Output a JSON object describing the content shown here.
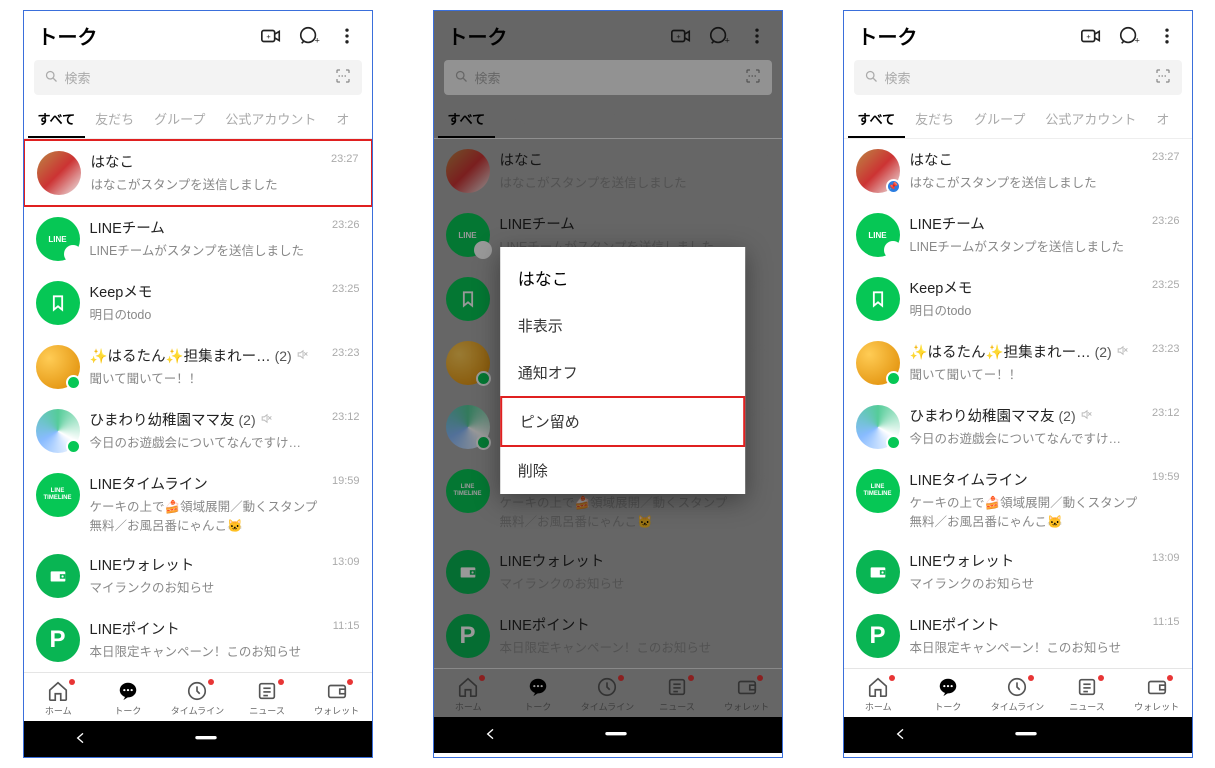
{
  "header": {
    "title": "トーク"
  },
  "search": {
    "placeholder": "検索"
  },
  "tabs": [
    "すべて",
    "友だち",
    "グループ",
    "公式アカウント",
    "オ"
  ],
  "chats": [
    {
      "name": "はなこ",
      "preview": "はなこがスタンプを送信しました",
      "time": "23:27",
      "avatar": "av-hanako"
    },
    {
      "name": "LINEチーム",
      "preview": "LINEチームがスタンプを送信しました",
      "time": "23:26",
      "avatar": "av-line"
    },
    {
      "name": "Keepメモ",
      "preview": "明日のtodo",
      "time": "23:25",
      "avatar": "av-keep"
    },
    {
      "name": "✨はるたん✨担集まれー…",
      "count": "(2)",
      "muted": true,
      "preview": "聞いて聞いてー！！",
      "time": "23:23",
      "avatar": "av-harutan",
      "badge": "green"
    },
    {
      "name": "ひまわり幼稚園ママ友",
      "count": "(2)",
      "muted": true,
      "preview": "今日のお遊戯会についてなんですけ…",
      "time": "23:12",
      "avatar": "av-himawari",
      "badge": "green"
    },
    {
      "name": "LINEタイムライン",
      "preview": "ケーキの上で🍰領域展開／動くスタンプ無料／お風呂番にゃんこ🐱",
      "time": "19:59",
      "avatar": "av-timeline"
    },
    {
      "name": "LINEウォレット",
      "preview": "マイランクのお知らせ",
      "time": "13:09",
      "avatar": "av-wallet"
    },
    {
      "name": "LINEポイント",
      "preview": "本日限定キャンペーン！このお知らせ",
      "time": "11:15",
      "avatar": "av-point"
    }
  ],
  "nav": [
    {
      "label": "ホーム",
      "icon": "home",
      "dot": true
    },
    {
      "label": "トーク",
      "icon": "talk",
      "active": true
    },
    {
      "label": "タイムライン",
      "icon": "timeline",
      "dot": true
    },
    {
      "label": "ニュース",
      "icon": "news",
      "dot": true
    },
    {
      "label": "ウォレット",
      "icon": "wallet",
      "dot": true
    }
  ],
  "context_menu": {
    "title": "はなこ",
    "items": [
      "非表示",
      "通知オフ",
      "ピン留め",
      "削除"
    ],
    "highlight_index": 2
  },
  "screens": [
    {
      "dim": false,
      "highlight_chat": 0,
      "show_menu": false,
      "pin_badge": false
    },
    {
      "dim": true,
      "highlight_chat": -1,
      "show_menu": true,
      "pin_badge": false
    },
    {
      "dim": false,
      "highlight_chat": -1,
      "show_menu": false,
      "pin_badge": true
    }
  ],
  "avatar_text": {
    "av-line": "LINE",
    "av-point": "P",
    "av-timeline": "LINE\nTIMELINE"
  }
}
